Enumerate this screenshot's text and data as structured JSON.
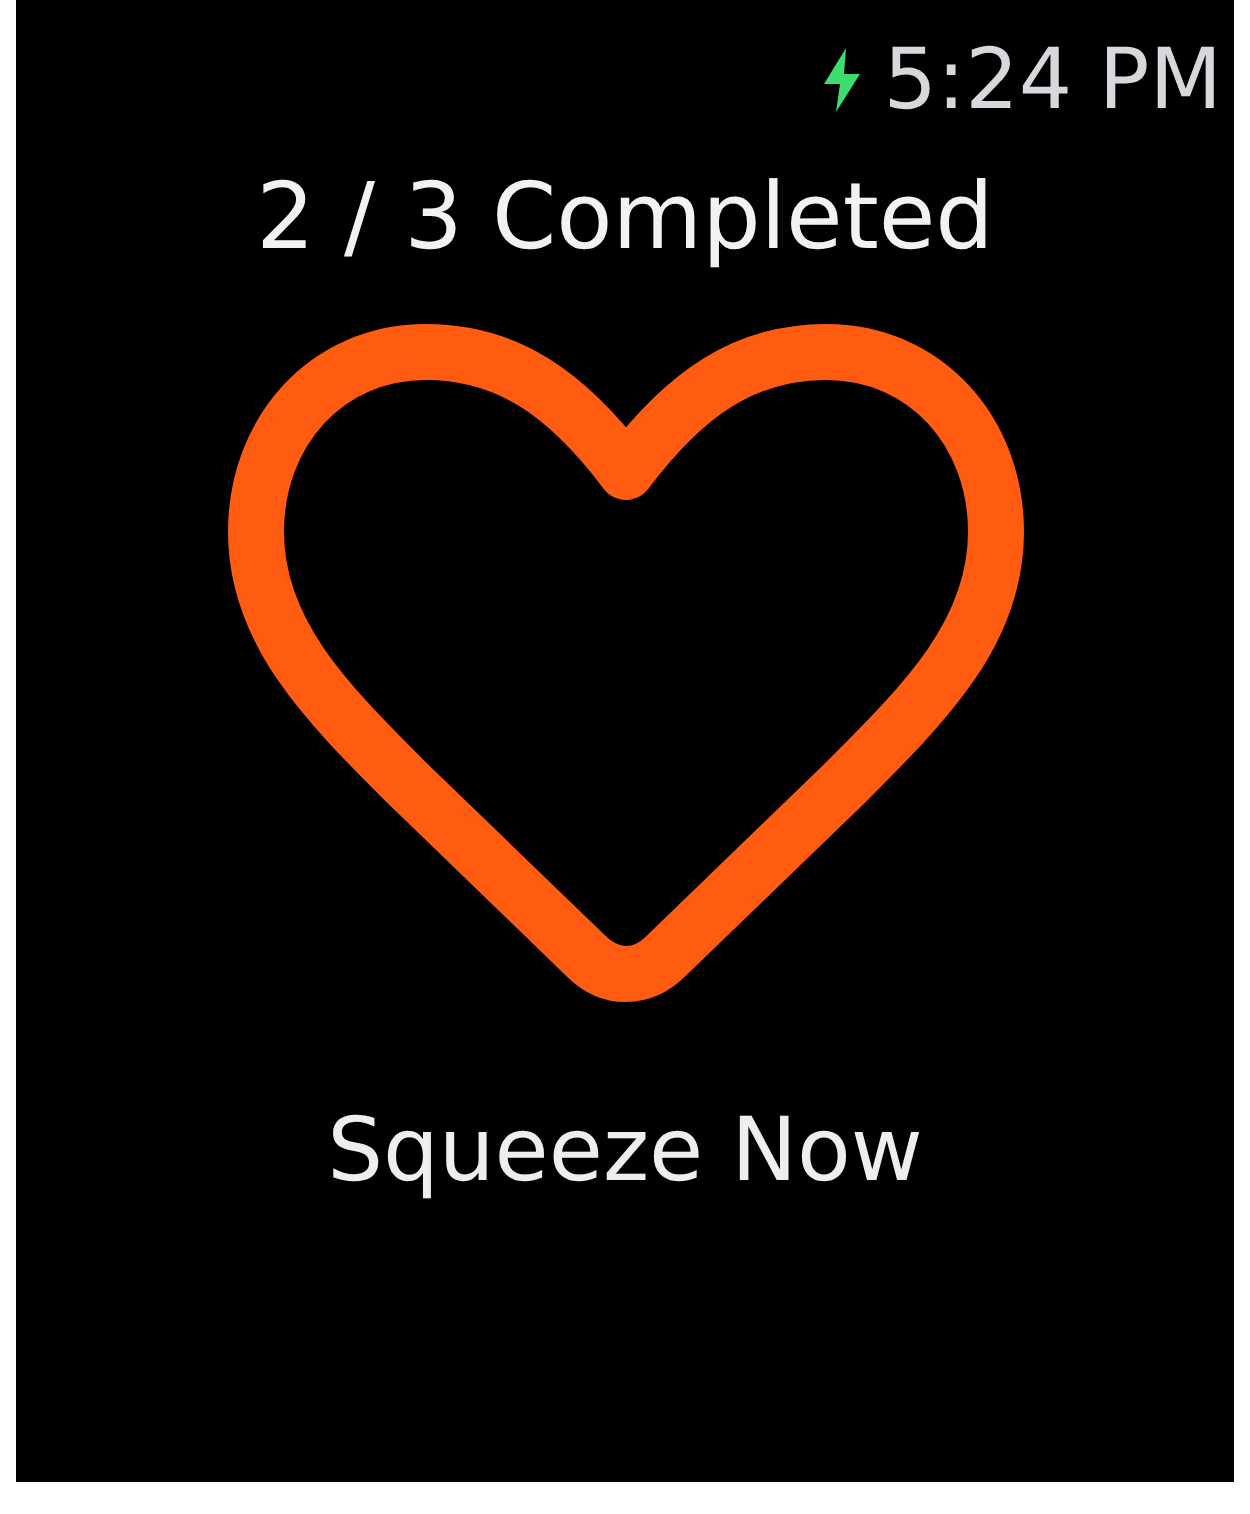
{
  "status_bar": {
    "charging": true,
    "time": "5:24 PM"
  },
  "progress": "2 / 3 Completed",
  "prompt": "Squeeze Now"
}
